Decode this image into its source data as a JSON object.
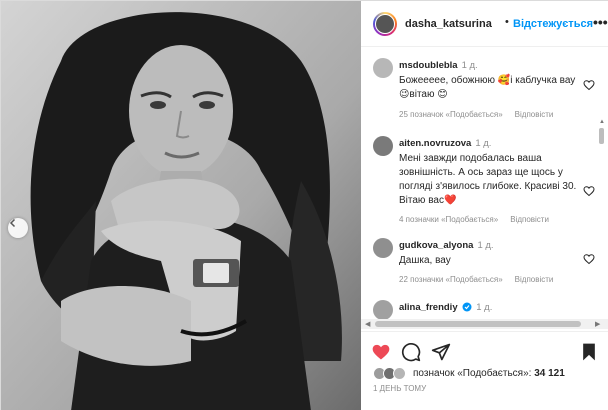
{
  "post": {
    "username": "dasha_katsurina",
    "separator": "•",
    "follow_label": "Відстежується",
    "more_label": "•••"
  },
  "comments": [
    {
      "username": "msdoublebla",
      "time": "1 д.",
      "text": "Божеееее, обожнюю 🥰і каблучка вау 😉вітаю 😊",
      "likes": "25 позначок «Подобається»",
      "reply": "Відповісти"
    },
    {
      "username": "aiten.novruzova",
      "time": "1 д.",
      "text": "Мені завжди подобалась ваша зовнішність. А ось зараз ще щось у погляді з'явилось глибоке. Красиві 30. Вітаю вас❤️",
      "likes": "4 позначки «Подобається»",
      "reply": "Відповісти"
    },
    {
      "username": "gudkova_alyona",
      "time": "1 д.",
      "text": "Дашка, вау",
      "likes": "22 позначки «Подобається»",
      "reply": "Відповісти"
    },
    {
      "username": "alina_frendiy",
      "time": "1 д.",
      "text": "",
      "likes": "",
      "reply": ""
    }
  ],
  "likes_summary": {
    "label": "позначок «Подобається»: ",
    "count": "34 121"
  },
  "posted_time": "1 ДЕНЬ ТОМУ",
  "icons": {
    "like": "heart-filled-icon",
    "comment": "comment-icon",
    "share": "paper-plane-icon",
    "save": "bookmark-icon",
    "prev": "chevron-left-icon",
    "comment_like": "heart-outline-icon",
    "verified": "verified-badge-icon"
  },
  "colors": {
    "accent": "#0095f6",
    "like": "#ed4956",
    "text": "#262626",
    "muted": "#8e8e8e"
  }
}
